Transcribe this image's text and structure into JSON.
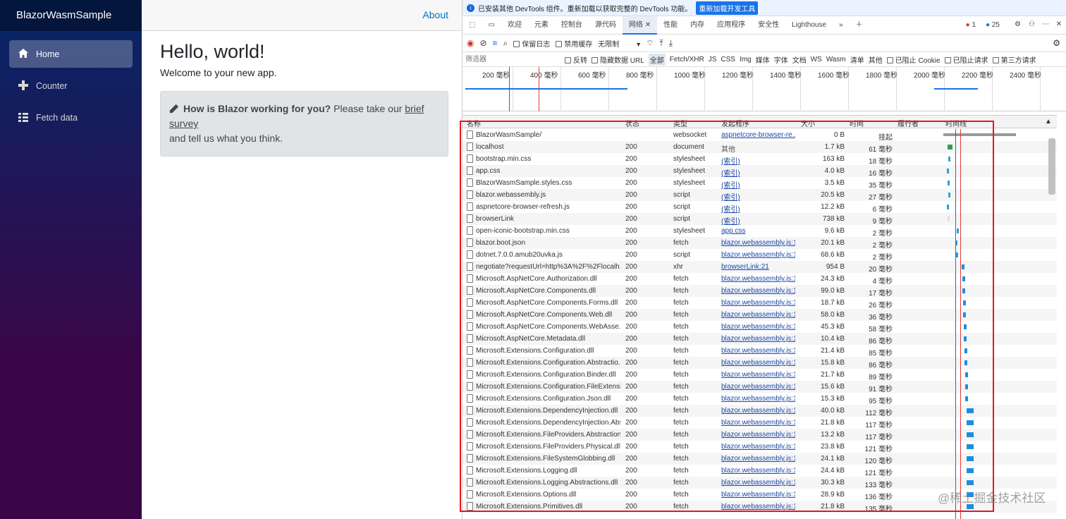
{
  "app": {
    "brand": "BlazorWasmSample",
    "nav": [
      {
        "label": "Home",
        "icon": "home-icon",
        "active": true
      },
      {
        "label": "Counter",
        "icon": "plus-icon",
        "active": false
      },
      {
        "label": "Fetch data",
        "icon": "list-icon",
        "active": false
      }
    ],
    "about": "About",
    "heading": "Hello, world!",
    "welcome": "Welcome to your new app.",
    "survey": {
      "bold": "How is Blazor working for you?",
      "text1": " Please take our ",
      "link": "brief survey",
      "text2": "and tell us what you think."
    }
  },
  "devtools": {
    "infobar": {
      "text": "已安装其他 DevTools 组件。重新加载以获取完整的 DevTools 功能。",
      "button": "重新加载开发工具"
    },
    "tabs": [
      "欢迎",
      "元素",
      "控制台",
      "源代码",
      "网络",
      "性能",
      "内存",
      "应用程序",
      "安全性",
      "Lighthouse"
    ],
    "selected_tab": "网络",
    "errors": "1",
    "warnings": "25",
    "toolbar": {
      "preserve_log": "保留日志",
      "disable_cache": "禁用缓存",
      "throttle": "无限制"
    },
    "filter": {
      "placeholder": "筛选器",
      "invert": "反转",
      "hide_data": "隐藏数据 URL",
      "types": [
        "全部",
        "Fetch/XHR",
        "JS",
        "CSS",
        "Img",
        "媒体",
        "字体",
        "文档",
        "WS",
        "Wasm",
        "清单",
        "其他"
      ],
      "blocked_cookies": "已阻止 Cookie",
      "blocked_requests": "已阻止请求",
      "third_party": "第三方请求"
    },
    "overview_ticks": [
      "200 毫秒",
      "400 毫秒",
      "600 毫秒",
      "800 毫秒",
      "1000 毫秒",
      "1200 毫秒",
      "1400 毫秒",
      "1600 毫秒",
      "1800 毫秒",
      "2000 毫秒",
      "2200 毫秒",
      "2400 毫秒"
    ],
    "columns": [
      "名称",
      "状态",
      "类型",
      "发起程序",
      "大小",
      "时间",
      "履行者",
      "时间线"
    ],
    "requests": [
      {
        "name": "BlazorWasmSample/",
        "status": "",
        "type": "websocket",
        "initiator": "aspnetcore-browser-re...",
        "size": "0 B",
        "time": "挂起"
      },
      {
        "name": "localhost",
        "status": "200",
        "type": "document",
        "initiator": "其他",
        "size": "1.7 kB",
        "time": "61 毫秒"
      },
      {
        "name": "bootstrap.min.css",
        "status": "200",
        "type": "stylesheet",
        "initiator": "(索引)",
        "size": "163 kB",
        "time": "18 毫秒"
      },
      {
        "name": "app.css",
        "status": "200",
        "type": "stylesheet",
        "initiator": "(索引)",
        "size": "4.0 kB",
        "time": "16 毫秒"
      },
      {
        "name": "BlazorWasmSample.styles.css",
        "status": "200",
        "type": "stylesheet",
        "initiator": "(索引)",
        "size": "3.5 kB",
        "time": "35 毫秒"
      },
      {
        "name": "blazor.webassembly.js",
        "status": "200",
        "type": "script",
        "initiator": "(索引)",
        "size": "20.5 kB",
        "time": "27 毫秒"
      },
      {
        "name": "aspnetcore-browser-refresh.js",
        "status": "200",
        "type": "script",
        "initiator": "(索引)",
        "size": "12.2 kB",
        "time": "6 毫秒"
      },
      {
        "name": "browserLink",
        "status": "200",
        "type": "script",
        "initiator": "(索引)",
        "size": "738 kB",
        "time": "9 毫秒"
      },
      {
        "name": "open-iconic-bootstrap.min.css",
        "status": "200",
        "type": "stylesheet",
        "initiator": "app.css",
        "size": "9.6 kB",
        "time": "2 毫秒"
      },
      {
        "name": "blazor.boot.json",
        "status": "200",
        "type": "fetch",
        "initiator": "blazor.webassembly.js:1",
        "size": "20.1 kB",
        "time": "2 毫秒"
      },
      {
        "name": "dotnet.7.0.0.amub20uvka.js",
        "status": "200",
        "type": "script",
        "initiator": "blazor.webassembly.js:1",
        "size": "68.6 kB",
        "time": "2 毫秒"
      },
      {
        "name": "negotiate?requestUrl=http%3A%2F%2Flocalh...",
        "status": "200",
        "type": "xhr",
        "initiator": "browserLink:21",
        "size": "954 B",
        "time": "20 毫秒"
      },
      {
        "name": "Microsoft.AspNetCore.Authorization.dll",
        "status": "200",
        "type": "fetch",
        "initiator": "blazor.webassembly.js:1",
        "size": "24.3 kB",
        "time": "4 毫秒"
      },
      {
        "name": "Microsoft.AspNetCore.Components.dll",
        "status": "200",
        "type": "fetch",
        "initiator": "blazor.webassembly.js:1",
        "size": "99.0 kB",
        "time": "17 毫秒"
      },
      {
        "name": "Microsoft.AspNetCore.Components.Forms.dll",
        "status": "200",
        "type": "fetch",
        "initiator": "blazor.webassembly.js:1",
        "size": "18.7 kB",
        "time": "26 毫秒"
      },
      {
        "name": "Microsoft.AspNetCore.Components.Web.dll",
        "status": "200",
        "type": "fetch",
        "initiator": "blazor.webassembly.js:1",
        "size": "58.0 kB",
        "time": "36 毫秒"
      },
      {
        "name": "Microsoft.AspNetCore.Components.WebAsse...",
        "status": "200",
        "type": "fetch",
        "initiator": "blazor.webassembly.js:1",
        "size": "45.3 kB",
        "time": "58 毫秒"
      },
      {
        "name": "Microsoft.AspNetCore.Metadata.dll",
        "status": "200",
        "type": "fetch",
        "initiator": "blazor.webassembly.js:1",
        "size": "10.4 kB",
        "time": "86 毫秒"
      },
      {
        "name": "Microsoft.Extensions.Configuration.dll",
        "status": "200",
        "type": "fetch",
        "initiator": "blazor.webassembly.js:1",
        "size": "21.4 kB",
        "time": "85 毫秒"
      },
      {
        "name": "Microsoft.Extensions.Configuration.Abstractio...",
        "status": "200",
        "type": "fetch",
        "initiator": "blazor.webassembly.js:1",
        "size": "15.8 kB",
        "time": "86 毫秒"
      },
      {
        "name": "Microsoft.Extensions.Configuration.Binder.dll",
        "status": "200",
        "type": "fetch",
        "initiator": "blazor.webassembly.js:1",
        "size": "21.7 kB",
        "time": "89 毫秒"
      },
      {
        "name": "Microsoft.Extensions.Configuration.FileExtensi...",
        "status": "200",
        "type": "fetch",
        "initiator": "blazor.webassembly.js:1",
        "size": "15.6 kB",
        "time": "91 毫秒"
      },
      {
        "name": "Microsoft.Extensions.Configuration.Json.dll",
        "status": "200",
        "type": "fetch",
        "initiator": "blazor.webassembly.js:1",
        "size": "15.3 kB",
        "time": "95 毫秒"
      },
      {
        "name": "Microsoft.Extensions.DependencyInjection.dll",
        "status": "200",
        "type": "fetch",
        "initiator": "blazor.webassembly.js:1",
        "size": "40.0 kB",
        "time": "112 毫秒"
      },
      {
        "name": "Microsoft.Extensions.DependencyInjection.Abs...",
        "status": "200",
        "type": "fetch",
        "initiator": "blazor.webassembly.js:1",
        "size": "21.8 kB",
        "time": "117 毫秒"
      },
      {
        "name": "Microsoft.Extensions.FileProviders.Abstraction...",
        "status": "200",
        "type": "fetch",
        "initiator": "blazor.webassembly.js:1",
        "size": "13.2 kB",
        "time": "117 毫秒"
      },
      {
        "name": "Microsoft.Extensions.FileProviders.Physical.dll",
        "status": "200",
        "type": "fetch",
        "initiator": "blazor.webassembly.js:1",
        "size": "23.8 kB",
        "time": "121 毫秒"
      },
      {
        "name": "Microsoft.Extensions.FileSystemGlobbing.dll",
        "status": "200",
        "type": "fetch",
        "initiator": "blazor.webassembly.js:1",
        "size": "24.1 kB",
        "time": "120 毫秒"
      },
      {
        "name": "Microsoft.Extensions.Logging.dll",
        "status": "200",
        "type": "fetch",
        "initiator": "blazor.webassembly.js:1",
        "size": "24.4 kB",
        "time": "121 毫秒"
      },
      {
        "name": "Microsoft.Extensions.Logging.Abstractions.dll",
        "status": "200",
        "type": "fetch",
        "initiator": "blazor.webassembly.js:1",
        "size": "30.3 kB",
        "time": "133 毫秒"
      },
      {
        "name": "Microsoft.Extensions.Options.dll",
        "status": "200",
        "type": "fetch",
        "initiator": "blazor.webassembly.js:1",
        "size": "28.9 kB",
        "time": "136 毫秒"
      },
      {
        "name": "Microsoft.Extensions.Primitives.dll",
        "status": "200",
        "type": "fetch",
        "initiator": "blazor.webassembly.js:1",
        "size": "21.8 kB",
        "time": "135 毫秒"
      }
    ],
    "watermark": "@稀土掘金技术社区"
  }
}
